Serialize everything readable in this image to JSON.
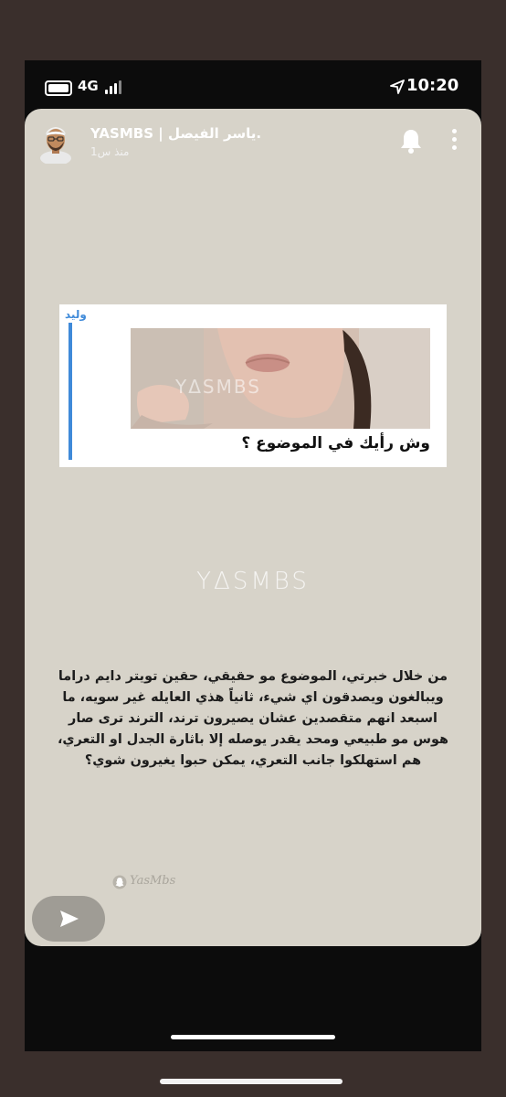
{
  "status_bar": {
    "network": "4G",
    "time": "10:20"
  },
  "story": {
    "user_name": "YASMBS | ياسر الفيصل.",
    "post_time": "منذ س1",
    "embed": {
      "author": "وليد",
      "video_watermark": "YΔSMBS",
      "caption": "وش رأيك في الموضوع ؟"
    },
    "center_watermark": "YΔSMBS",
    "body_lines": [
      "من خلال خبرتي، الموضوع مو حقيقي، حقين تويتر دايم دراما",
      "ويبالغون ويصدقون اي شيء، ثانياً هذي العايله غير سويه، ما",
      "اسبعد انهم متقصدين عشان يصيرون ترند، الترند ترى صار",
      "هوس مو طبيعي ومحد يقدر يوصله إلا باثارة الجدل او التعري،",
      "هم استهلكوا جانب التعري، يمكن حبوا يغيرون شوي؟"
    ],
    "signature": "YasMbs"
  },
  "icons": {
    "bell": "bell-icon",
    "more": "more-vertical-icon",
    "send": "send-arrow-icon",
    "location": "location-arrow-icon"
  },
  "colors": {
    "story_bg": "#d7d3c9",
    "accent_blue": "#3f8ad9",
    "frame": "#3a2f2c"
  }
}
